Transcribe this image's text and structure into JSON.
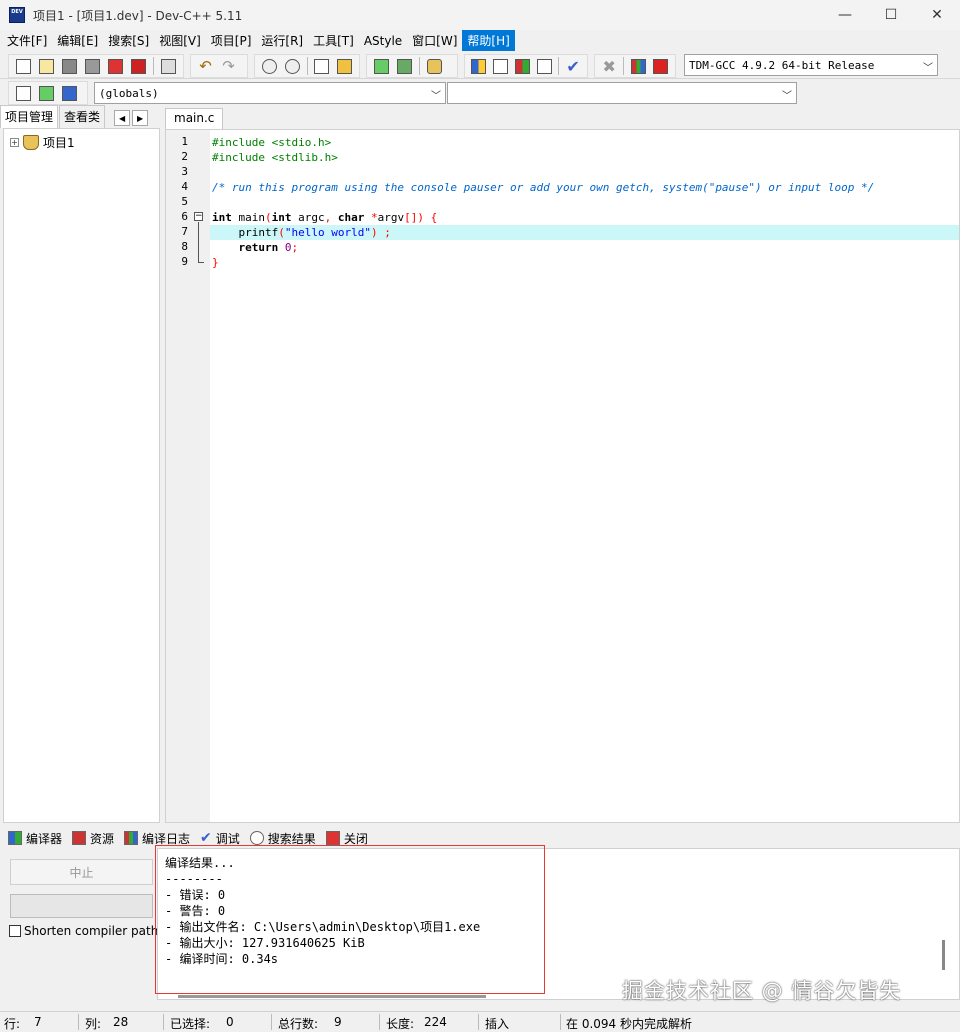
{
  "window": {
    "title": "项目1 - [项目1.dev] - Dev-C++ 5.11",
    "app_icon_text": "DEV",
    "minimize": "—",
    "maximize": "☐",
    "close": "✕"
  },
  "menu": {
    "items": [
      "文件[F]",
      "编辑[E]",
      "搜索[S]",
      "视图[V]",
      "项目[P]",
      "运行[R]",
      "工具[T]",
      "AStyle",
      "窗口[W]",
      "帮助[H]"
    ],
    "active": "帮助[H]"
  },
  "toolbar": {
    "compiler_select": "TDM-GCC 4.9.2 64-bit Release",
    "scope_select": "(globals)",
    "function_select": ""
  },
  "project_panel": {
    "tabs": [
      "项目管理",
      "查看类"
    ],
    "tree_root": "项目1",
    "expander": "+"
  },
  "editor": {
    "tab_name": "main.c",
    "highlighted_line": 7,
    "lines": [
      {
        "n": "1"
      },
      {
        "n": "2"
      },
      {
        "n": "3"
      },
      {
        "n": "4"
      },
      {
        "n": "5"
      },
      {
        "n": "6"
      },
      {
        "n": "7"
      },
      {
        "n": "8"
      },
      {
        "n": "9"
      }
    ],
    "code": {
      "l1_pp": "#include <stdio.h>",
      "l2_pp": "#include <stdlib.h>",
      "l4_cm": "/* run this program using the console pauser or add your own getch, system(\"pause\") or input loop */",
      "l6_a": "int",
      "l6_b": " main",
      "l6_c": "(",
      "l6_d": "int",
      "l6_e": " argc",
      "l6_f": ",",
      "l6_g": " char",
      "l6_h": " *",
      "l6_i": "argv",
      "l6_j": "[])",
      "l6_k": " {",
      "l7_a": "    printf",
      "l7_b": "(",
      "l7_c": "\"hello world\"",
      "l7_d": ")",
      "l7_e": " ;",
      "l8_a": "    return",
      "l8_b": " 0",
      "l8_c": ";",
      "l9_a": "}"
    }
  },
  "bottom_panel": {
    "tabs": [
      "编译器",
      "资源",
      "编译日志",
      "调试",
      "搜索结果",
      "关闭"
    ],
    "abort_button": "中止",
    "progress": 0,
    "shorten_paths_label": "Shorten compiler paths",
    "log": "编译结果...\n--------\n- 错误: 0\n- 警告: 0\n- 输出文件名: C:\\Users\\admin\\Desktop\\项目1.exe\n- 输出大小: 127.931640625 KiB\n- 编译时间: 0.34s"
  },
  "watermark": "掘金技术社区 @ 情谷欠皆失",
  "status": {
    "row_label": "行:",
    "row": "7",
    "col_label": "列:",
    "col": "28",
    "sel_label": "已选择:",
    "sel": "0",
    "lines_label": "总行数:",
    "lines": "9",
    "len_label": "长度:",
    "len": "224",
    "mode": "插入",
    "parse": "在 0.094 秒内完成解析"
  },
  "colors": {
    "menu_active": "#0078d7",
    "highlight_line": "#ccf7f9",
    "comment": "#0066cc",
    "preprocessor": "#008000",
    "symbol": "#ff0000",
    "string": "#0000ff",
    "annotation_box": "#e53935"
  }
}
